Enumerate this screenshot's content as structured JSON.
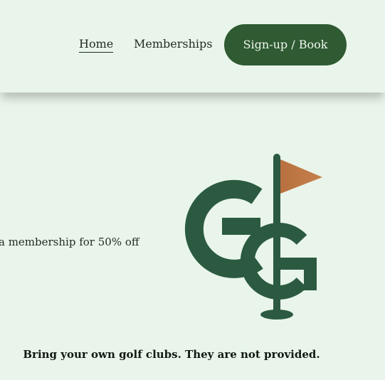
{
  "header": {
    "nav": {
      "home_label": "Home",
      "memberships_label": "Memberships"
    },
    "cta_label": "Sign-up / Book"
  },
  "hero": {
    "promo_text": "a membership for 50% off",
    "logo": {
      "icon": "golf-flag-gg-logo-icon",
      "colors": {
        "letters": "#2b5a40",
        "flag": "#b87040"
      }
    }
  },
  "footer_notice": "Bring your own golf clubs. They are not provided.",
  "colors": {
    "background": "#e9f5ea",
    "button": "#2f5a32",
    "button_text": "#f2f7f0",
    "text": "#1f2a22"
  }
}
